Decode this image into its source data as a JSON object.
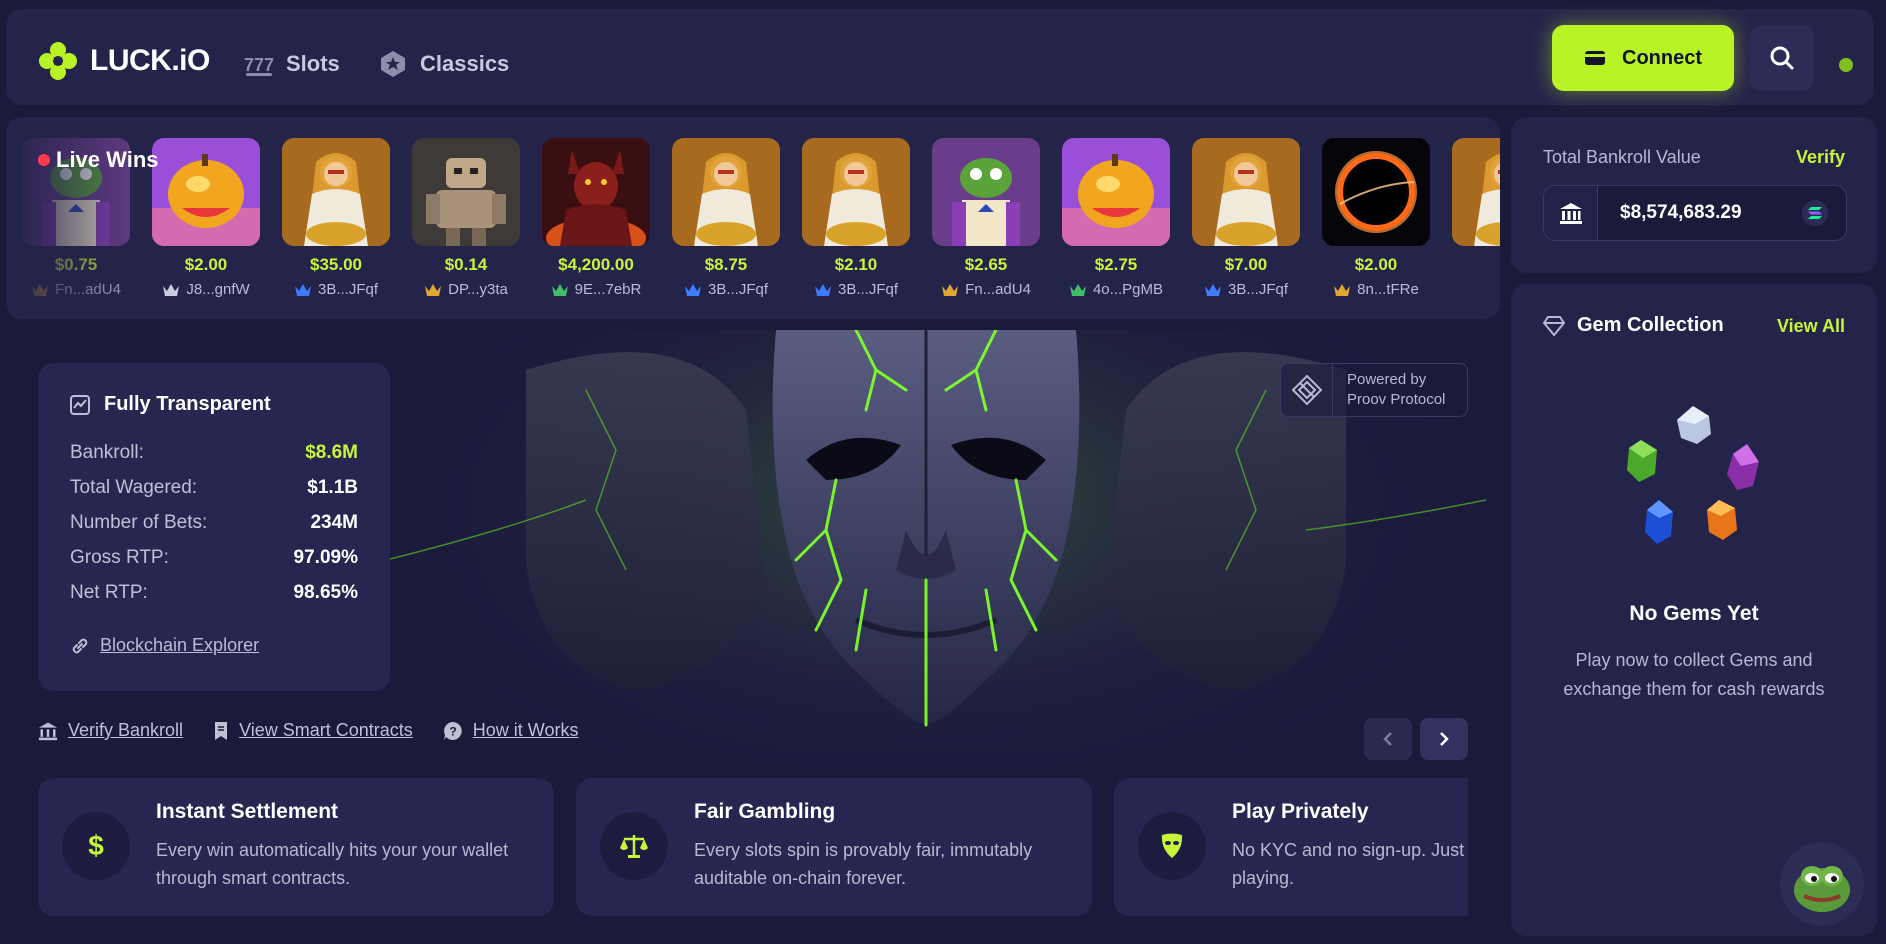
{
  "header": {
    "logo_text": "LUCK.iO",
    "nav": [
      {
        "label": "Slots",
        "icon": "slots-icon"
      },
      {
        "label": "Classics",
        "icon": "classics-icon"
      }
    ],
    "connect_label": "Connect",
    "accent_color": "#b8f325"
  },
  "live_wins": {
    "title": "Live Wins",
    "items": [
      {
        "amount": "$0.75",
        "user": "Fn...adU4",
        "game": "frog-gentleman",
        "tier": "gold"
      },
      {
        "amount": "$2.00",
        "user": "J8...gnfW",
        "game": "candy-fruit",
        "tier": "silver"
      },
      {
        "amount": "$35.00",
        "user": "3B...JFqf",
        "game": "golden-goddess",
        "tier": "blue"
      },
      {
        "amount": "$0.14",
        "user": "DP...y3ta",
        "game": "robot",
        "tier": "gold"
      },
      {
        "amount": "$4,200.00",
        "user": "9E...7ebR",
        "game": "demon",
        "tier": "green"
      },
      {
        "amount": "$8.75",
        "user": "3B...JFqf",
        "game": "golden-goddess",
        "tier": "blue"
      },
      {
        "amount": "$2.10",
        "user": "3B...JFqf",
        "game": "golden-goddess",
        "tier": "blue"
      },
      {
        "amount": "$2.65",
        "user": "Fn...adU4",
        "game": "frog-gentleman",
        "tier": "gold"
      },
      {
        "amount": "$2.75",
        "user": "4o...PgMB",
        "game": "candy-fruit",
        "tier": "green"
      },
      {
        "amount": "$7.00",
        "user": "3B...JFqf",
        "game": "golden-goddess",
        "tier": "blue"
      },
      {
        "amount": "$2.00",
        "user": "8n...tFRe",
        "game": "black-hole",
        "tier": "gold"
      }
    ]
  },
  "bankroll": {
    "title": "Total Bankroll Value",
    "verify_label": "Verify",
    "value": "$8,574,683.29"
  },
  "gems": {
    "title": "Gem Collection",
    "view_all": "View All",
    "empty_title": "No Gems Yet",
    "empty_desc": "Play now to collect Gems and exchange them for cash rewards"
  },
  "transparency": {
    "title": "Fully Transparent",
    "stats": [
      {
        "label": "Bankroll:",
        "value": "$8.6M"
      },
      {
        "label": "Total Wagered:",
        "value": "$1.1B"
      },
      {
        "label": "Number of Bets:",
        "value": "234M"
      },
      {
        "label": "Gross RTP:",
        "value": "97.09%"
      },
      {
        "label": "Net RTP:",
        "value": "98.65%"
      }
    ],
    "explorer_link": "Blockchain Explorer"
  },
  "powered_by": {
    "line1": "Powered by",
    "line2": "Proov Protocol"
  },
  "bottom_links": [
    {
      "label": "Verify Bankroll"
    },
    {
      "label": "View Smart Contracts"
    },
    {
      "label": "How it Works"
    }
  ],
  "features": [
    {
      "title": "Instant Settlement",
      "desc": "Every win automatically hits your your wallet through smart contracts.",
      "icon": "dollar-icon",
      "glyph": "$"
    },
    {
      "title": "Fair Gambling",
      "desc": "Every slots spin is provably fair, immutably auditable on-chain forever.",
      "icon": "scales-icon"
    },
    {
      "title": "Play Privately",
      "desc": "No KYC and no sign-up. Just c wallet and start playing.",
      "icon": "mask-icon"
    }
  ]
}
